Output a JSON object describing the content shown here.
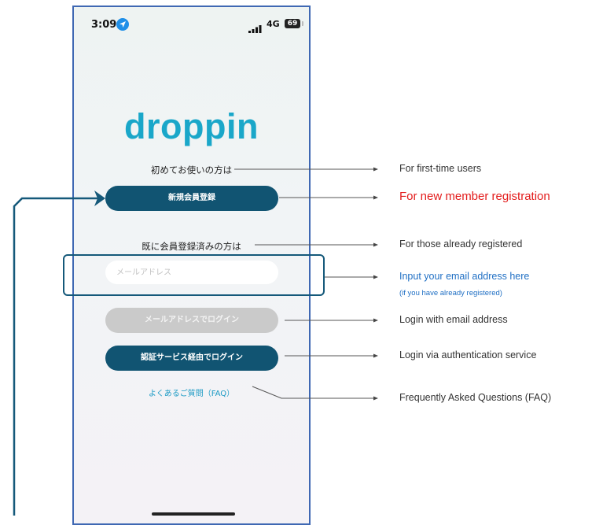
{
  "status_bar": {
    "time": "3:09",
    "network": "4G",
    "battery": "69"
  },
  "app": {
    "logo": "droppin",
    "first_time_label": "初めてお使いの方は",
    "register_button": "新規会員登録",
    "registered_label": "既に会員登録済みの方は",
    "email_placeholder": "メールアドレス",
    "email_login_button": "メールアドレスでログイン",
    "auth_login_button": "認証サービス経由でログイン",
    "faq_link": "よくあるご質問（FAQ）"
  },
  "annotations": {
    "first_time": "For first-time users",
    "new_member": "For new member registration",
    "already_registered": "For those already registered",
    "input_email": "Input your email address here",
    "input_email_sub": "(if you have already registered)",
    "login_email": "Login with email address",
    "login_auth": "Login via authentication service",
    "faq": "Frequently Asked Questions (FAQ)"
  },
  "colors": {
    "primary_button": "#115472",
    "logo": "#1aa7c9",
    "annotation_red": "#e31b1b",
    "annotation_blue": "#1f6fc4",
    "phone_border": "#3f68b3"
  }
}
